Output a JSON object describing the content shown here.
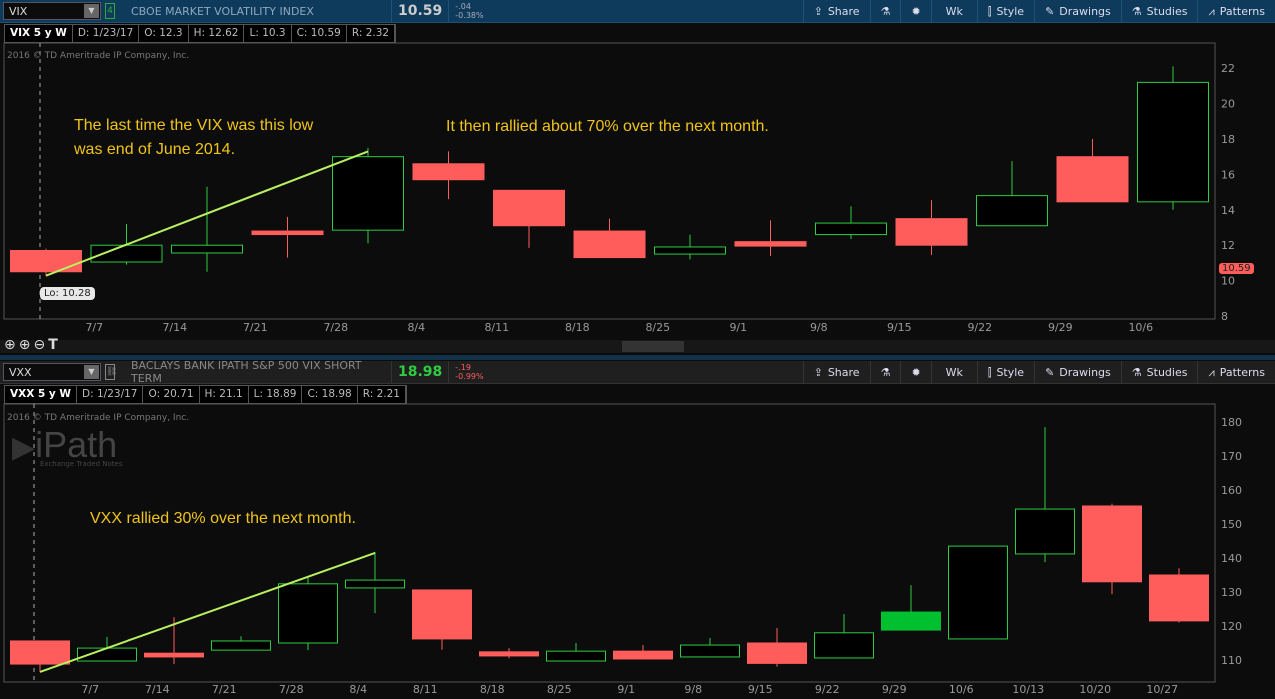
{
  "top": {
    "symbol": "VIX",
    "description": "CBOE MARKET VOLATILITY INDEX",
    "last": "10.59",
    "change": "-.04",
    "change_pct": "-0.38%",
    "link": "4",
    "header": {
      "study": "VIX 5 y W",
      "date": "D: 1/23/17",
      "open": "O: 12.3",
      "high": "H: 12.62",
      "low": "L: 10.3",
      "close": "C: 10.59",
      "range": "R: 2.32"
    },
    "copyright": "2016 © TD Ameritrade IP Company, Inc.",
    "lo_label": "Lo: 10.28",
    "price_tag": "10.59",
    "annotation1_line1": "The last time the VIX was this low",
    "annotation1_line2": "was end of June 2014.",
    "annotation2": "It then rallied about 70% over the next month."
  },
  "bottom": {
    "symbol": "VXX",
    "description": "BACLAYS BANK IPATH S&P 500 VIX SHORT TERM",
    "last": "18.98",
    "change": "-.19",
    "change_pct": "-0.99%",
    "header": {
      "study": "VXX 5 y W",
      "date": "D: 1/23/17",
      "open": "O: 20.71",
      "high": "H: 21.1",
      "low": "L: 18.89",
      "close": "C: 18.98",
      "range": "R: 2.21"
    },
    "copyright": "2016 © TD Ameritrade IP Company, Inc.",
    "logo_text": "iPath",
    "logo_sub": "Exchange Traded Notes",
    "annotation": "VXX rallied 30% over the next month."
  },
  "toolbar": {
    "share": "Share",
    "wk": "Wk",
    "style": "Style",
    "drawings": "Drawings",
    "studies": "Studies",
    "patterns": "Patterns"
  },
  "colors": {
    "up": "#2ecc40",
    "down": "#ff5c5c",
    "trend": "#b8f060",
    "filled_up": "#00c030",
    "annotation": "#f0c419"
  },
  "chart_data": [
    {
      "type": "candlestick",
      "title": "VIX 5 y W",
      "ylim": [
        8,
        23
      ],
      "yticks": [
        8,
        10,
        12,
        14,
        16,
        18,
        20,
        22
      ],
      "xticks": [
        "7/7",
        "7/14",
        "7/21",
        "7/28",
        "8/4",
        "8/11",
        "8/18",
        "8/25",
        "9/1",
        "9/8",
        "9/15",
        "9/22",
        "9/29",
        "10/6"
      ],
      "candles": [
        [
          11.7,
          11.8,
          10.28,
          10.5
        ],
        [
          11.05,
          13.2,
          10.9,
          12.0
        ],
        [
          11.56,
          15.3,
          10.5,
          12.0
        ],
        [
          12.8,
          13.6,
          11.3,
          12.6
        ],
        [
          12.85,
          17.5,
          12.1,
          17.0
        ],
        [
          16.6,
          17.3,
          14.6,
          15.7
        ],
        [
          15.1,
          15.1,
          11.85,
          13.1
        ],
        [
          12.8,
          13.5,
          11.3,
          11.3
        ],
        [
          11.5,
          12.6,
          11.2,
          11.9
        ],
        [
          12.2,
          13.4,
          11.4,
          11.95
        ],
        [
          12.6,
          14.2,
          12.35,
          13.25
        ],
        [
          13.5,
          14.55,
          11.45,
          12.0
        ],
        [
          13.1,
          16.75,
          13.1,
          14.8
        ],
        [
          17.0,
          18.0,
          14.45,
          14.45
        ],
        [
          14.45,
          22.1,
          14.0,
          21.2
        ]
      ],
      "trendline": [
        [
          0,
          10.28
        ],
        [
          4,
          17.3
        ]
      ]
    },
    {
      "type": "candlestick",
      "title": "VXX 5 y W",
      "ylim": [
        104,
        184
      ],
      "yticks": [
        110,
        120,
        130,
        140,
        150,
        160,
        170,
        180
      ],
      "xticks": [
        "7/7",
        "7/14",
        "7/21",
        "7/28",
        "8/4",
        "8/11",
        "8/18",
        "8/25",
        "9/1",
        "9/8",
        "9/15",
        "9/22",
        "9/29",
        "10/6",
        "10/13",
        "10/20",
        "10/27"
      ],
      "candles": [
        [
          115.6,
          115.6,
          106.5,
          108.8
        ],
        [
          109.7,
          116.8,
          109.7,
          113.5
        ],
        [
          112,
          122.6,
          108.8,
          110.9
        ],
        [
          112.9,
          117,
          112.9,
          115.6
        ],
        [
          115,
          134.7,
          112.9,
          132.4
        ],
        [
          131.2,
          141.8,
          123.8,
          133.5
        ],
        [
          130.6,
          130.6,
          113,
          116.2
        ],
        [
          112.4,
          113.5,
          110.5,
          111.2
        ],
        [
          109.7,
          115,
          109.7,
          112.6
        ],
        [
          112.6,
          114.4,
          110.3,
          110.3
        ],
        [
          110.9,
          116.5,
          110.9,
          114.4
        ],
        [
          115,
          119.4,
          108,
          109
        ],
        [
          110.6,
          123.5,
          110.6,
          118
        ],
        [
          118.8,
          132,
          118.8,
          124.1,
          "filled"
        ],
        [
          116.2,
          143.5,
          116.2,
          143.5
        ],
        [
          141.2,
          178.5,
          138.8,
          154.4
        ],
        [
          155.3,
          156,
          129.4,
          133
        ],
        [
          135,
          137,
          121,
          121.5
        ]
      ],
      "trendline": [
        [
          0,
          106.5
        ],
        [
          5,
          141.5
        ]
      ]
    }
  ]
}
